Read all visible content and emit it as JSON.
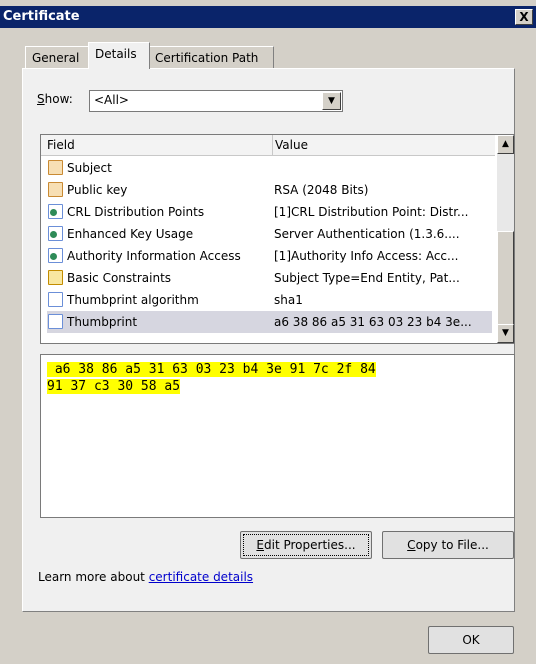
{
  "window": {
    "title": "Certificate",
    "close_label": "X"
  },
  "tabs": [
    {
      "label": "General"
    },
    {
      "label": "Details"
    },
    {
      "label": "Certification Path"
    }
  ],
  "show": {
    "label_prefix": "S",
    "label_rest": "how:",
    "value": "<All>"
  },
  "table": {
    "columns": {
      "field": "Field",
      "value": "Value"
    },
    "rows": [
      {
        "icon": "cert-doc-icon",
        "field": "Subject",
        "value": ""
      },
      {
        "icon": "cert-doc-icon",
        "field": "Public key",
        "value": "RSA (2048 Bits)"
      },
      {
        "icon": "extension-icon",
        "field": "CRL Distribution Points",
        "value": "[1]CRL Distribution Point: Distr..."
      },
      {
        "icon": "extension-icon",
        "field": "Enhanced Key Usage",
        "value": "Server Authentication (1.3.6...."
      },
      {
        "icon": "extension-icon",
        "field": "Authority Information Access",
        "value": "[1]Authority Info Access: Acc..."
      },
      {
        "icon": "warning-icon",
        "field": "Basic Constraints",
        "value": "Subject Type=End Entity, Pat..."
      },
      {
        "icon": "page-icon",
        "field": "Thumbprint algorithm",
        "value": "sha1"
      },
      {
        "icon": "page-icon",
        "field": "Thumbprint",
        "value": "a6 38 86 a5 31 63 03 23 b4 3e...",
        "selected": true
      }
    ]
  },
  "detail_text": {
    "line1": " a6 38 86 a5 31 63 03 23 b4 3e 91 7c 2f 84",
    "line2": "91 37 c3 30 58 a5"
  },
  "buttons": {
    "edit_prefix": "E",
    "edit_rest": "dit Properties...",
    "copy_prefix": "C",
    "copy_rest": "opy to File...",
    "ok": "OK"
  },
  "learn_more": {
    "text": "Learn more about ",
    "link": "certificate details"
  },
  "colors": {
    "title_bar": "#0a246a",
    "highlight": "#ffff00",
    "link": "#0000cc"
  }
}
